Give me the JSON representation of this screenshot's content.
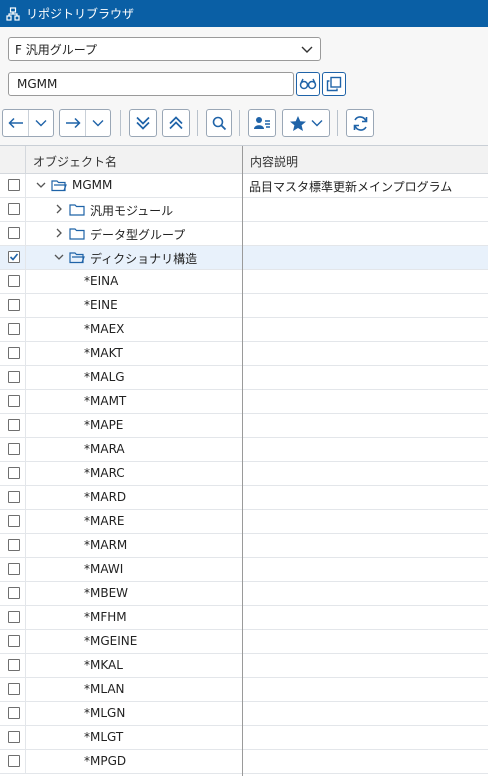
{
  "window": {
    "title": "リポジトリブラウザ"
  },
  "object_type": {
    "selected": "F 汎用グループ"
  },
  "object_name": {
    "value": "MGMM",
    "placeholder": ""
  },
  "icons": {
    "title": "repository-icon",
    "display": "glasses-icon",
    "other_object": "copy-icon",
    "back": "arrow-left-icon",
    "forward": "arrow-right-icon",
    "expand_all": "double-chevron-down-icon",
    "collapse_all": "double-chevron-up-icon",
    "find": "search-icon",
    "worklist": "user-list-icon",
    "favorites": "star-icon",
    "refresh": "refresh-icon",
    "folder": "folder-icon",
    "folder_open": "folder-open-icon"
  },
  "colors": {
    "titlebar": "#0a5fa5",
    "accent": "#1f63a8"
  },
  "tree": {
    "columns": [
      "オブジェクト名",
      "内容説明"
    ],
    "rows": [
      {
        "name": "MGMM",
        "desc": "品目マスタ標準更新メインプログラム",
        "level": 0,
        "expanded": true,
        "icon": "folder-open-icon",
        "checked": false
      },
      {
        "name": "汎用モジュール",
        "desc": "",
        "level": 1,
        "expanded": false,
        "icon": "folder-icon",
        "checked": false
      },
      {
        "name": "データ型グループ",
        "desc": "",
        "level": 1,
        "expanded": false,
        "icon": "folder-icon",
        "checked": false
      },
      {
        "name": "ディクショナリ構造",
        "desc": "",
        "level": 1,
        "expanded": true,
        "icon": "folder-open-icon",
        "checked": true
      },
      {
        "name": "*EINA",
        "desc": "",
        "level": 2,
        "checked": false
      },
      {
        "name": "*EINE",
        "desc": "",
        "level": 2,
        "checked": false
      },
      {
        "name": "*MAEX",
        "desc": "",
        "level": 2,
        "checked": false
      },
      {
        "name": "*MAKT",
        "desc": "",
        "level": 2,
        "checked": false
      },
      {
        "name": "*MALG",
        "desc": "",
        "level": 2,
        "checked": false
      },
      {
        "name": "*MAMT",
        "desc": "",
        "level": 2,
        "checked": false
      },
      {
        "name": "*MAPE",
        "desc": "",
        "level": 2,
        "checked": false
      },
      {
        "name": "*MARA",
        "desc": "",
        "level": 2,
        "checked": false
      },
      {
        "name": "*MARC",
        "desc": "",
        "level": 2,
        "checked": false
      },
      {
        "name": "*MARD",
        "desc": "",
        "level": 2,
        "checked": false
      },
      {
        "name": "*MARE",
        "desc": "",
        "level": 2,
        "checked": false
      },
      {
        "name": "*MARM",
        "desc": "",
        "level": 2,
        "checked": false
      },
      {
        "name": "*MAWI",
        "desc": "",
        "level": 2,
        "checked": false
      },
      {
        "name": "*MBEW",
        "desc": "",
        "level": 2,
        "checked": false
      },
      {
        "name": "*MFHM",
        "desc": "",
        "level": 2,
        "checked": false
      },
      {
        "name": "*MGEINE",
        "desc": "",
        "level": 2,
        "checked": false
      },
      {
        "name": "*MKAL",
        "desc": "",
        "level": 2,
        "checked": false
      },
      {
        "name": "*MLAN",
        "desc": "",
        "level": 2,
        "checked": false
      },
      {
        "name": "*MLGN",
        "desc": "",
        "level": 2,
        "checked": false
      },
      {
        "name": "*MLGT",
        "desc": "",
        "level": 2,
        "checked": false
      },
      {
        "name": "*MPGD",
        "desc": "",
        "level": 2,
        "checked": false
      }
    ]
  }
}
